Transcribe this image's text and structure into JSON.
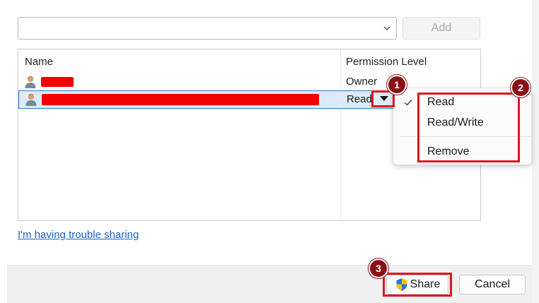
{
  "top": {
    "add_label": "Add"
  },
  "list": {
    "headers": {
      "name": "Name",
      "permission": "Permission Level"
    },
    "rows": [
      {
        "permission": "Owner"
      },
      {
        "permission": "Read"
      }
    ]
  },
  "link": {
    "trouble": "I'm having trouble sharing"
  },
  "menu": {
    "items": [
      "Read",
      "Read/Write",
      "Remove"
    ],
    "checked": "Read"
  },
  "footer": {
    "share_label": "Share",
    "cancel_label": "Cancel"
  },
  "annotations": {
    "badges": [
      "1",
      "2",
      "3"
    ],
    "color": "#e0161e",
    "badge_color": "#8a1217"
  },
  "colors": {
    "link": "#1a62c6",
    "selection": "#dcebfb",
    "redaction": "#f20000"
  }
}
